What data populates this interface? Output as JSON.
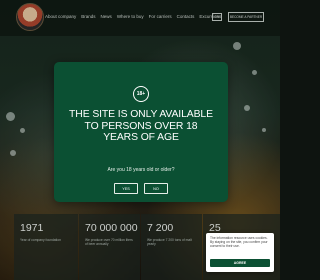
{
  "header": {
    "nav": [
      {
        "label": "About company",
        "name": "nav-about-company"
      },
      {
        "label": "Brands",
        "name": "nav-brands"
      },
      {
        "label": "News",
        "name": "nav-news"
      },
      {
        "label": "Where to buy",
        "name": "nav-where-to-buy"
      },
      {
        "label": "For carriers",
        "name": "nav-for-carriers"
      },
      {
        "label": "Contacts",
        "name": "nav-contacts"
      },
      {
        "label": "Excursions",
        "name": "nav-excursions"
      }
    ],
    "lang": "EN",
    "partner_button": "BECOME A PARTNER"
  },
  "age_gate": {
    "badge": "18+",
    "title": "THE SITE IS ONLY AVAILABLE TO PERSONS OVER 18 YEARS OF AGE",
    "question": "Are you 18 years old or older?",
    "yes": "YES",
    "no": "NO"
  },
  "stats": [
    {
      "value": "1971",
      "label": "Year of company foundation"
    },
    {
      "value": "70 000 000",
      "label": "We produce over 70 million liters of beer annually"
    },
    {
      "value": "7 200",
      "label": "We produce 7 200 tons of malt yearly"
    },
    {
      "value": "25",
      "label": ""
    }
  ],
  "cookie": {
    "text": "The information resource uses cookies. By staying on the site, you confirm your consent to their use.",
    "button": "AGREE"
  },
  "colors": {
    "modal_bg": "#0b5033",
    "cookie_button": "#0b5033"
  }
}
